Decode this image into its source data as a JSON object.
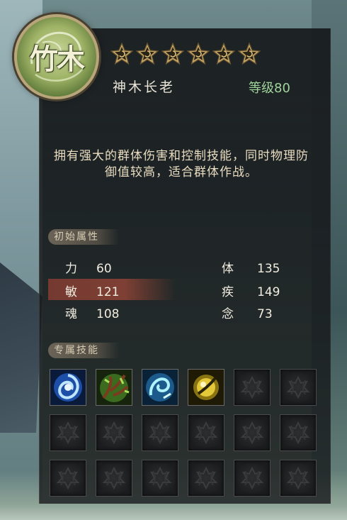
{
  "character": {
    "emblem_text": "竹木",
    "name": "神木长老",
    "level": "等级80",
    "star_count": 6
  },
  "description": "拥有强大的群体伤害和控制技能，同时物理防御值较高，适合群体作战。",
  "attributes": {
    "section_label": "初始属性",
    "items": [
      {
        "key": "力",
        "value": "60"
      },
      {
        "key": "敏",
        "value": "121"
      },
      {
        "key": "魂",
        "value": "108"
      },
      {
        "key": "体",
        "value": "135"
      },
      {
        "key": "疾",
        "value": "149"
      },
      {
        "key": "念",
        "value": "73"
      }
    ]
  },
  "skills": {
    "section_label": "专属技能",
    "slots": [
      {
        "type": "skill",
        "icon": "blue-vortex-icon"
      },
      {
        "type": "skill",
        "icon": "green-vine-icon"
      },
      {
        "type": "skill",
        "icon": "cyan-whirl-icon"
      },
      {
        "type": "skill",
        "icon": "golden-orb-icon"
      },
      {
        "type": "empty"
      },
      {
        "type": "empty"
      },
      {
        "type": "empty"
      },
      {
        "type": "empty"
      },
      {
        "type": "empty"
      },
      {
        "type": "empty"
      },
      {
        "type": "empty"
      },
      {
        "type": "empty"
      },
      {
        "type": "empty"
      },
      {
        "type": "empty"
      },
      {
        "type": "empty"
      },
      {
        "type": "empty"
      },
      {
        "type": "empty"
      },
      {
        "type": "empty"
      }
    ]
  },
  "colors": {
    "level": "#9fd49a",
    "description": "#e9dcc0",
    "highlight_row": "#96463a"
  }
}
